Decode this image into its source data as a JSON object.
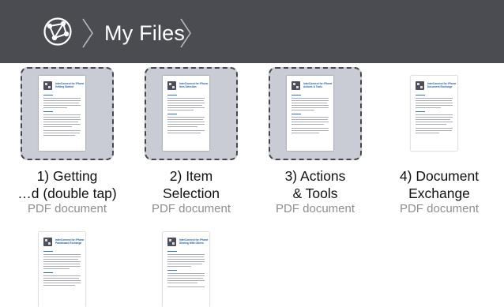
{
  "header": {
    "breadcrumb_title": "My Files",
    "background_color": "#4a4c52",
    "root_icon": "globe-network-icon",
    "separator_icon": "chevron-right-icon"
  },
  "files": [
    {
      "title_line1": "1) Getting",
      "title_line2": "…d (double tap)",
      "kind": "PDF document",
      "selected": true,
      "doc_heading_line1": "InterConnect for iPhone",
      "doc_heading_line2": "Getting Started"
    },
    {
      "title_line1": "2) Item",
      "title_line2": "Selection",
      "kind": "PDF document",
      "selected": true,
      "doc_heading_line1": "InterConnect for iPhone",
      "doc_heading_line2": "Item Selection"
    },
    {
      "title_line1": "3) Actions",
      "title_line2": "& Tools",
      "kind": "PDF document",
      "selected": true,
      "doc_heading_line1": "InterConnect for iPhone",
      "doc_heading_line2": "Actions & Tools"
    },
    {
      "title_line1": "4) Document",
      "title_line2": "Exchange",
      "kind": "PDF document",
      "selected": false,
      "doc_heading_line1": "InterConnect for iPhone",
      "doc_heading_line2": "Document Exchange"
    },
    {
      "title_line1": "",
      "title_line2": "",
      "kind": "",
      "selected": false,
      "doc_heading_line1": "InterConnect for iPhone",
      "doc_heading_line2": "Pasteboard Exchange"
    },
    {
      "title_line1": "",
      "title_line2": "",
      "kind": "",
      "selected": false,
      "doc_heading_line1": "InterConnect for iPhone",
      "doc_heading_line2": "Sharing With Others"
    }
  ]
}
